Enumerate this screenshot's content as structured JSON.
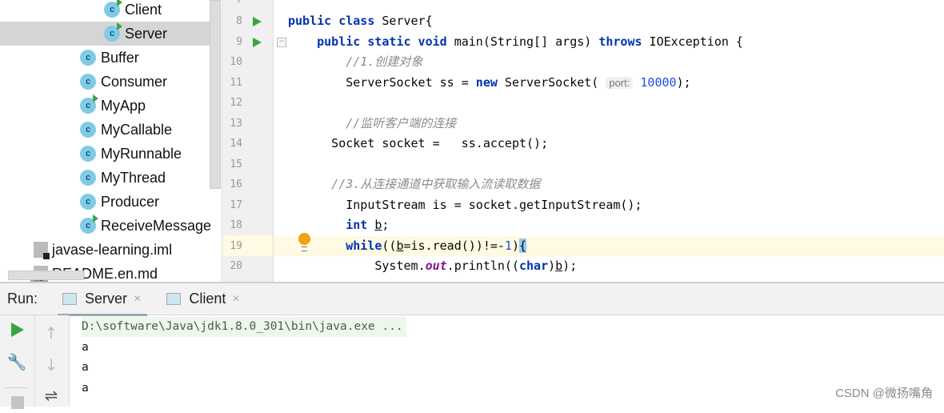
{
  "project_tree": {
    "items": [
      {
        "label": "Client",
        "icon": "java-class-runnable-icon",
        "indent": 1,
        "selected": false
      },
      {
        "label": "Server",
        "icon": "java-class-runnable-icon",
        "indent": 1,
        "selected": true
      },
      {
        "label": "Buffer",
        "icon": "java-class-icon",
        "indent": 0
      },
      {
        "label": "Consumer",
        "icon": "java-class-icon",
        "indent": 0
      },
      {
        "label": "MyApp",
        "icon": "java-class-runnable-icon",
        "indent": 0
      },
      {
        "label": "MyCallable",
        "icon": "java-class-icon",
        "indent": 0
      },
      {
        "label": "MyRunnable",
        "icon": "java-class-icon",
        "indent": 0
      },
      {
        "label": "MyThread",
        "icon": "java-class-icon",
        "indent": 0
      },
      {
        "label": "Producer",
        "icon": "java-class-icon",
        "indent": 0
      },
      {
        "label": "ReceiveMessage",
        "icon": "java-class-runnable-icon",
        "indent": 0
      },
      {
        "label": "javase-learning.iml",
        "icon": "iml-file-icon",
        "indent": -1
      },
      {
        "label": "README.en.md",
        "icon": "markdown-file-icon",
        "indent": -1
      }
    ],
    "class_badge": "c",
    "md_badge": "MD"
  },
  "editor": {
    "first_line_partial": "7",
    "lines": [
      {
        "n": "8",
        "run": true,
        "indent": 0,
        "tokens": [
          [
            "public class ",
            "kw"
          ],
          [
            "Server{",
            ""
          ]
        ]
      },
      {
        "n": "9",
        "run": true,
        "fold": true,
        "indent": 4,
        "tokens": [
          [
            "public static void ",
            "kw"
          ],
          [
            "main(String[] args) ",
            ""
          ],
          [
            "throws ",
            "kw"
          ],
          [
            "IOException {",
            ""
          ]
        ]
      },
      {
        "n": "10",
        "indent": 8,
        "tokens": [
          [
            "//1.创建对象",
            "cm"
          ]
        ]
      },
      {
        "n": "11",
        "indent": 8,
        "tokens": [
          [
            "ServerSocket ss = ",
            ""
          ],
          [
            "new ",
            "kw"
          ],
          [
            "ServerSocket( ",
            ""
          ],
          [
            "port:",
            "hint"
          ],
          [
            " ",
            ""
          ],
          [
            "10000",
            "num"
          ],
          [
            ");",
            ""
          ]
        ]
      },
      {
        "n": "12",
        "indent": 0,
        "tokens": []
      },
      {
        "n": "13",
        "indent": 8,
        "tokens": [
          [
            "//监听客户端的连接",
            "cm"
          ]
        ]
      },
      {
        "n": "14",
        "indent": 6,
        "tokens": [
          [
            "Socket socket =   ss.accept();",
            ""
          ]
        ]
      },
      {
        "n": "15",
        "indent": 0,
        "tokens": []
      },
      {
        "n": "16",
        "indent": 6,
        "tokens": [
          [
            "//3.从连接通道中获取输入流读取数据",
            "cm"
          ]
        ]
      },
      {
        "n": "17",
        "indent": 8,
        "tokens": [
          [
            "InputStream is = socket.getInputStream();",
            ""
          ]
        ]
      },
      {
        "n": "18",
        "indent": 8,
        "tokens": [
          [
            "int ",
            "kw"
          ],
          [
            "b",
            "ul"
          ],
          [
            ";",
            ""
          ]
        ]
      },
      {
        "n": "19",
        "fold": true,
        "bulb": true,
        "current": true,
        "indent": 8,
        "tokens": [
          [
            "while",
            "kw"
          ],
          [
            "((",
            ""
          ],
          [
            "b",
            "ul"
          ],
          [
            "=is.read())!=-",
            ""
          ],
          [
            "1",
            "num"
          ],
          [
            ")",
            ""
          ],
          [
            "{",
            "brace"
          ]
        ]
      },
      {
        "n": "20",
        "indent": 12,
        "tokens": [
          [
            "System.",
            ""
          ],
          [
            "out",
            "st"
          ],
          [
            ".println((",
            ""
          ],
          [
            "char",
            "kw"
          ],
          [
            ")",
            ""
          ],
          [
            "b",
            "ul"
          ],
          [
            ");",
            ""
          ]
        ]
      }
    ]
  },
  "run_panel": {
    "label": "Run:",
    "tabs": [
      {
        "label": "Server",
        "active": true,
        "close": "×"
      },
      {
        "label": "Client",
        "active": false,
        "close": "×"
      }
    ],
    "tools": {
      "rerun": "play-icon",
      "settings": "wrench-icon",
      "stop": "stop-icon",
      "up": "arrow-up-icon",
      "down": "arrow-down-icon",
      "wrap": "soft-wrap-icon"
    },
    "console": [
      "D:\\software\\Java\\jdk1.8.0_301\\bin\\java.exe ...",
      "a",
      "a",
      "a"
    ]
  },
  "watermark": "CSDN @微扬嘴角",
  "colors": {
    "keyword": "#0033b3",
    "comment": "#8c8c8c",
    "number": "#1750eb",
    "run_green": "#3aa542",
    "current_line": "#fefae3"
  }
}
